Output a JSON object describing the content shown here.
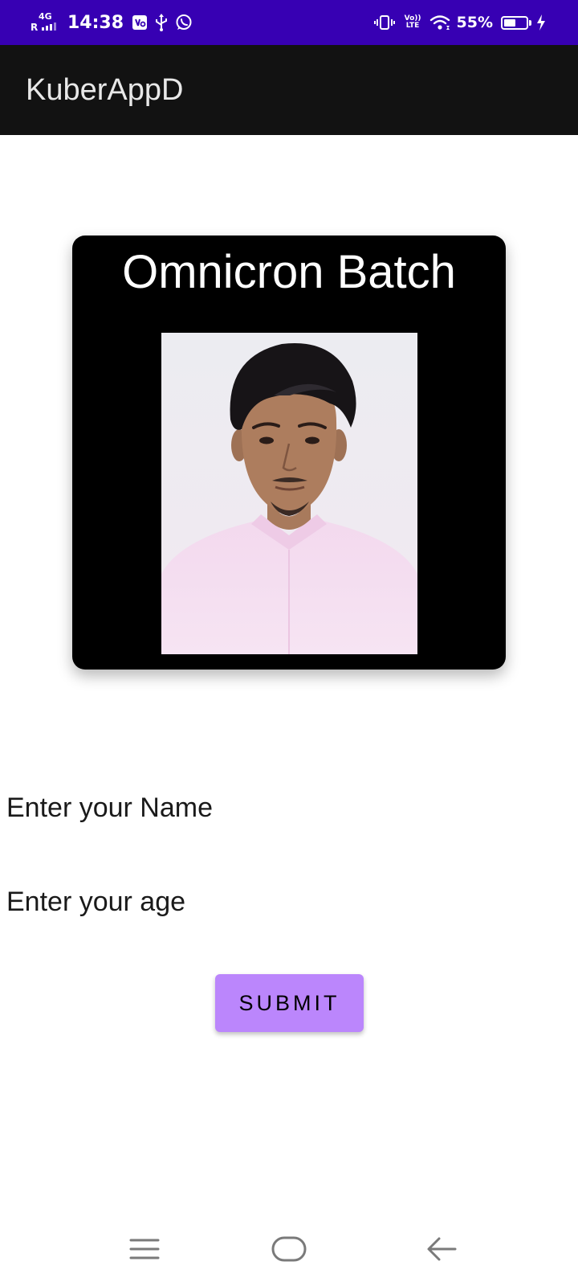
{
  "status_bar": {
    "network_type": "4G",
    "roaming": "R",
    "time": "14:38",
    "left_icons": [
      "vpn-key-icon",
      "usb-icon",
      "whatsapp-icon"
    ],
    "right_icons": [
      "vibrate-icon",
      "volte-icon",
      "wifi-icon"
    ],
    "volte_top": "Vo))",
    "volte_bottom": "LTE",
    "battery_percent_text": "55%",
    "battery_level": 0.55,
    "charging": true,
    "background": "#3700b3"
  },
  "app_bar": {
    "title": "KuberAppD",
    "background": "#121212"
  },
  "card": {
    "title": "Omnicron Batch",
    "background": "#000000"
  },
  "form": {
    "name_placeholder": "Enter your Name",
    "age_placeholder": "Enter your age",
    "submit_label": "SUBMIT",
    "submit_color": "#bb86fc"
  },
  "nav_bar": {
    "icons": [
      "menu-icon",
      "home-icon",
      "back-icon"
    ]
  }
}
